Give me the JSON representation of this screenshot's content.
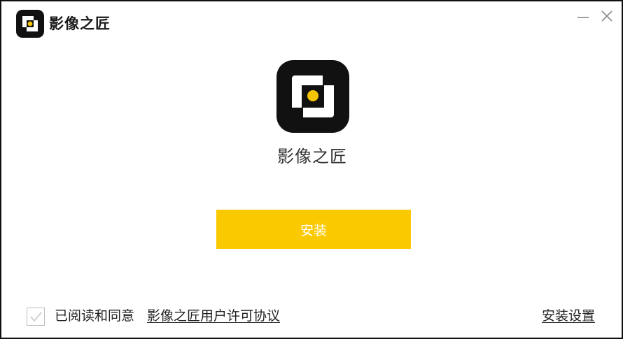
{
  "title_bar": {
    "app_title": "影像之匠",
    "logo_icon": "app-logo-icon",
    "minimize_icon": "minimize-icon",
    "close_icon": "close-icon"
  },
  "main": {
    "app_name": "影像之匠",
    "install_label": "安装"
  },
  "footer": {
    "agree_checked": true,
    "agree_text": "已阅读和同意",
    "license_link": "影像之匠用户许可协议",
    "settings_link": "安装设置"
  },
  "colors": {
    "accent": "#fbc900",
    "logo_dark": "#111111",
    "logo_dot": "#f5c400",
    "text": "#222222"
  }
}
